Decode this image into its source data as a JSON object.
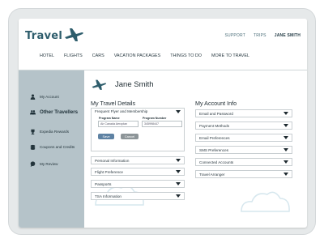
{
  "header": {
    "logo_text": "Travel",
    "util_nav": [
      "SUPPORT",
      "TRIPS",
      "JANE SMITH"
    ],
    "main_nav": [
      "HOTEL",
      "FLIGHTS",
      "CARS",
      "VACATION PACKAGES",
      "THINGS TO DO",
      "MORE TO TRAVEL"
    ]
  },
  "sidebar": {
    "items": [
      {
        "label": "My Account",
        "icon": "person-icon"
      },
      {
        "label": "Other Travellers",
        "icon": "people-icon"
      },
      {
        "label": "Expedia Rewards",
        "icon": "trophy-icon"
      },
      {
        "label": "Coupons and Credits",
        "icon": "coins-icon"
      },
      {
        "label": "My Review",
        "icon": "chat-icon"
      }
    ]
  },
  "profile": {
    "name": "Jane Smith"
  },
  "travel_details": {
    "title": "My Travel Details",
    "expanded": {
      "label": "Frequent Flyer and Membership",
      "program_name_label": "Program Name",
      "program_name_value": "Air Canada Aeroplan",
      "program_number_label": "Program Number",
      "program_number_value": "345998447",
      "save_label": "Save",
      "cancel_label": "Cancel"
    },
    "rows": [
      "Personal Information",
      "Flight Preference",
      "Passports",
      "TSA Information"
    ]
  },
  "account_info": {
    "title": "My Account Info",
    "rows": [
      "Email and Password",
      "Payment Methods",
      "Email Preferences",
      "SMS Preferences",
      "Connected Accounts",
      "Travel Arranger"
    ]
  },
  "colors": {
    "sidebar": "#b5c3c9",
    "accent": "#2e5d6c",
    "save": "#5e82a3"
  }
}
